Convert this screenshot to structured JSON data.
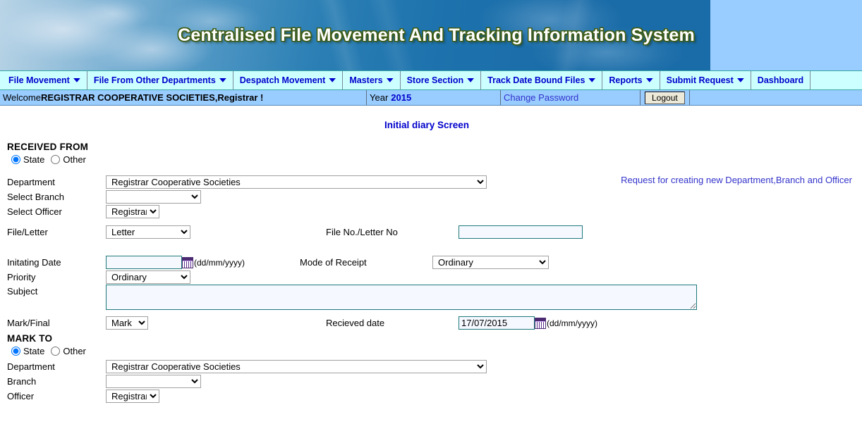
{
  "banner": {
    "title": "Centralised File Movement And  Tracking Information System",
    "bg_color": "#1a6ca8",
    "right_panel_color": "#99ccff",
    "title_color": "#ffffff",
    "title_outline_color": "#3f5d16"
  },
  "menu": {
    "bg_color": "#ccffff",
    "text_color": "#0000cc",
    "items": [
      {
        "label": "File Movement",
        "has_caret": true
      },
      {
        "label": "File From Other Departments",
        "has_caret": true
      },
      {
        "label": "Despatch Movement",
        "has_caret": true
      },
      {
        "label": "Masters",
        "has_caret": true
      },
      {
        "label": "Store Section",
        "has_caret": true
      },
      {
        "label": "Track Date Bound Files",
        "has_caret": true
      },
      {
        "label": "Reports",
        "has_caret": true
      },
      {
        "label": "Submit Request",
        "has_caret": true
      },
      {
        "label": "Dashboard",
        "has_caret": false
      }
    ]
  },
  "welcome_bar": {
    "bg_color": "#99ccff",
    "welcome_prefix": "Welcome ",
    "user_name": "REGISTRAR COOPERATIVE SOCIETIES,Registrar !",
    "year_label": "Year",
    "year_value": "2015",
    "change_password_label": "Change Password",
    "logout_label": "Logout"
  },
  "page": {
    "title": "Initial diary Screen",
    "title_color": "#0000cc"
  },
  "received_from": {
    "heading": "RECEIVED FROM",
    "radio_state_label": "State",
    "radio_other_label": "Other",
    "radio_selected": "State",
    "department_label": "Department",
    "department_value": "Registrar Cooperative Societies",
    "branch_label": "Select Branch",
    "branch_value": "",
    "officer_label": "Select Officer",
    "officer_value": "Registrar",
    "request_link": "Request for creating new Department,Branch and Officer",
    "request_link_color": "#3333cc"
  },
  "details": {
    "file_letter_label": "File/Letter",
    "file_letter_value": "Letter",
    "file_no_label": "File No./Letter No",
    "file_no_value": "",
    "initiating_date_label": "Initating Date",
    "initiating_date_value": "",
    "date_format_hint": "(dd/mm/yyyy)",
    "mode_of_receipt_label": "Mode of Receipt",
    "mode_of_receipt_value": "Ordinary",
    "priority_label": "Priority",
    "priority_value": "Ordinary",
    "subject_label": "Subject",
    "subject_value": "",
    "mark_final_label": "Mark/Final",
    "mark_final_value": "Mark",
    "received_date_label": "Recieved date",
    "received_date_value": "17/07/2015"
  },
  "mark_to": {
    "heading": "MARK TO",
    "radio_state_label": "State",
    "radio_other_label": "Other",
    "radio_selected": "State",
    "department_label": "Department",
    "department_value": "Registrar Cooperative Societies",
    "branch_label": "Branch",
    "branch_value": "",
    "officer_label": "Officer",
    "officer_value": "Registrar"
  }
}
